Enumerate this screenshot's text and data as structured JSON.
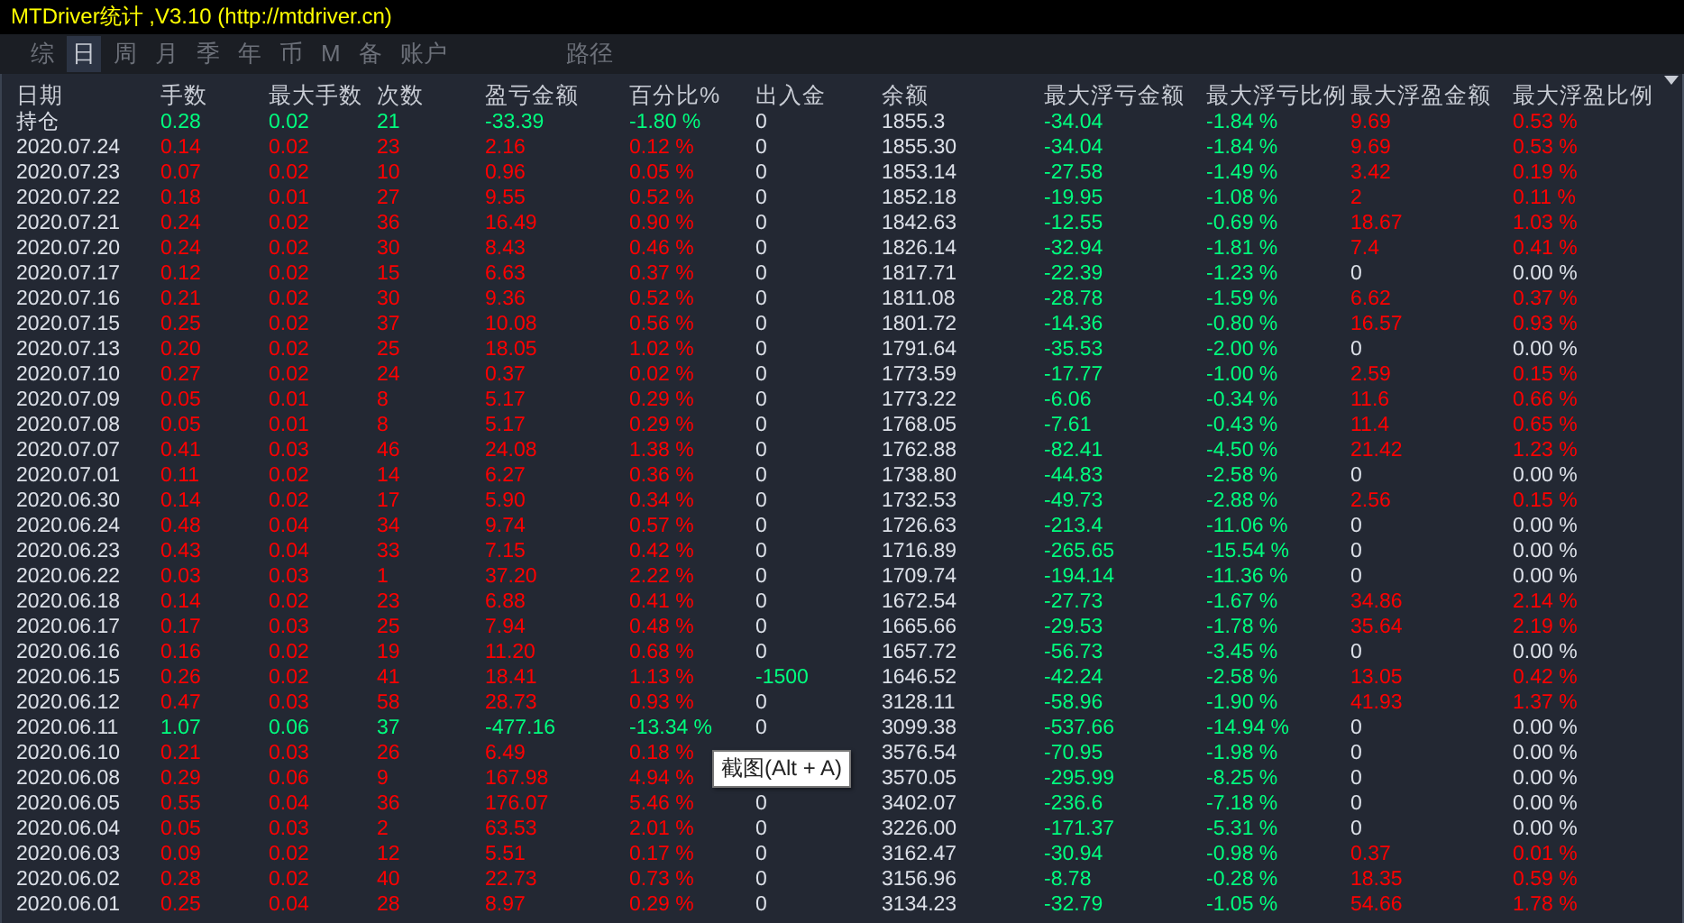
{
  "window": {
    "title": "MTDriver统计 ,V3.10 (http://mtdriver.cn)"
  },
  "tabs": [
    {
      "label": "综",
      "selected": false
    },
    {
      "label": "日",
      "selected": true
    },
    {
      "label": "周",
      "selected": false
    },
    {
      "label": "月",
      "selected": false
    },
    {
      "label": "季",
      "selected": false
    },
    {
      "label": "年",
      "selected": false
    },
    {
      "label": "币",
      "selected": false
    },
    {
      "label": "M",
      "selected": false
    },
    {
      "label": "备",
      "selected": false
    },
    {
      "label": "账户",
      "selected": false
    }
  ],
  "path_button": "路径",
  "table": {
    "columns": [
      "日期",
      "手数",
      "最大手数",
      "次数",
      "盈亏金额",
      "百分比%",
      "出入金",
      "余额",
      "最大浮亏金额",
      "最大浮亏比例",
      "最大浮盈金额",
      "最大浮盈比例"
    ],
    "rows": [
      {
        "cells": [
          "持仓",
          "0.28",
          "0.02",
          "21",
          "-33.39",
          "-1.80 %",
          "0",
          "1855.3",
          "-34.04",
          "-1.84 %",
          "9.69",
          "0.53 %"
        ],
        "loss": true,
        "float_gain": true,
        "cash_out": false
      },
      {
        "cells": [
          "2020.07.24",
          "0.14",
          "0.02",
          "23",
          "2.16",
          "0.12 %",
          "0",
          "1855.30",
          "-34.04",
          "-1.84 %",
          "9.69",
          "0.53 %"
        ],
        "loss": false,
        "float_gain": true,
        "cash_out": false
      },
      {
        "cells": [
          "2020.07.23",
          "0.07",
          "0.02",
          "10",
          "0.96",
          "0.05 %",
          "0",
          "1853.14",
          "-27.58",
          "-1.49 %",
          "3.42",
          "0.19 %"
        ],
        "loss": false,
        "float_gain": true,
        "cash_out": false
      },
      {
        "cells": [
          "2020.07.22",
          "0.18",
          "0.01",
          "27",
          "9.55",
          "0.52 %",
          "0",
          "1852.18",
          "-19.95",
          "-1.08 %",
          "2",
          "0.11 %"
        ],
        "loss": false,
        "float_gain": true,
        "cash_out": false
      },
      {
        "cells": [
          "2020.07.21",
          "0.24",
          "0.02",
          "36",
          "16.49",
          "0.90 %",
          "0",
          "1842.63",
          "-12.55",
          "-0.69 %",
          "18.67",
          "1.03 %"
        ],
        "loss": false,
        "float_gain": true,
        "cash_out": false
      },
      {
        "cells": [
          "2020.07.20",
          "0.24",
          "0.02",
          "30",
          "8.43",
          "0.46 %",
          "0",
          "1826.14",
          "-32.94",
          "-1.81 %",
          "7.4",
          "0.41 %"
        ],
        "loss": false,
        "float_gain": true,
        "cash_out": false
      },
      {
        "cells": [
          "2020.07.17",
          "0.12",
          "0.02",
          "15",
          "6.63",
          "0.37 %",
          "0",
          "1817.71",
          "-22.39",
          "-1.23 %",
          "0",
          "0.00 %"
        ],
        "loss": false,
        "float_gain": false,
        "cash_out": false
      },
      {
        "cells": [
          "2020.07.16",
          "0.21",
          "0.02",
          "30",
          "9.36",
          "0.52 %",
          "0",
          "1811.08",
          "-28.78",
          "-1.59 %",
          "6.62",
          "0.37 %"
        ],
        "loss": false,
        "float_gain": true,
        "cash_out": false
      },
      {
        "cells": [
          "2020.07.15",
          "0.25",
          "0.02",
          "37",
          "10.08",
          "0.56 %",
          "0",
          "1801.72",
          "-14.36",
          "-0.80 %",
          "16.57",
          "0.93 %"
        ],
        "loss": false,
        "float_gain": true,
        "cash_out": false
      },
      {
        "cells": [
          "2020.07.13",
          "0.20",
          "0.02",
          "25",
          "18.05",
          "1.02 %",
          "0",
          "1791.64",
          "-35.53",
          "-2.00 %",
          "0",
          "0.00 %"
        ],
        "loss": false,
        "float_gain": false,
        "cash_out": false
      },
      {
        "cells": [
          "2020.07.10",
          "0.27",
          "0.02",
          "24",
          "0.37",
          "0.02 %",
          "0",
          "1773.59",
          "-17.77",
          "-1.00 %",
          "2.59",
          "0.15 %"
        ],
        "loss": false,
        "float_gain": true,
        "cash_out": false
      },
      {
        "cells": [
          "2020.07.09",
          "0.05",
          "0.01",
          "8",
          "5.17",
          "0.29 %",
          "0",
          "1773.22",
          "-6.06",
          "-0.34 %",
          "11.6",
          "0.66 %"
        ],
        "loss": false,
        "float_gain": true,
        "cash_out": false
      },
      {
        "cells": [
          "2020.07.08",
          "0.05",
          "0.01",
          "8",
          "5.17",
          "0.29 %",
          "0",
          "1768.05",
          "-7.61",
          "-0.43 %",
          "11.4",
          "0.65 %"
        ],
        "loss": false,
        "float_gain": true,
        "cash_out": false
      },
      {
        "cells": [
          "2020.07.07",
          "0.41",
          "0.03",
          "46",
          "24.08",
          "1.38 %",
          "0",
          "1762.88",
          "-82.41",
          "-4.50 %",
          "21.42",
          "1.23 %"
        ],
        "loss": false,
        "float_gain": true,
        "cash_out": false
      },
      {
        "cells": [
          "2020.07.01",
          "0.11",
          "0.02",
          "14",
          "6.27",
          "0.36 %",
          "0",
          "1738.80",
          "-44.83",
          "-2.58 %",
          "0",
          "0.00 %"
        ],
        "loss": false,
        "float_gain": false,
        "cash_out": false
      },
      {
        "cells": [
          "2020.06.30",
          "0.14",
          "0.02",
          "17",
          "5.90",
          "0.34 %",
          "0",
          "1732.53",
          "-49.73",
          "-2.88 %",
          "2.56",
          "0.15 %"
        ],
        "loss": false,
        "float_gain": true,
        "cash_out": false
      },
      {
        "cells": [
          "2020.06.24",
          "0.48",
          "0.04",
          "34",
          "9.74",
          "0.57 %",
          "0",
          "1726.63",
          "-213.4",
          "-11.06 %",
          "0",
          "0.00 %"
        ],
        "loss": false,
        "float_gain": false,
        "cash_out": false
      },
      {
        "cells": [
          "2020.06.23",
          "0.43",
          "0.04",
          "33",
          "7.15",
          "0.42 %",
          "0",
          "1716.89",
          "-265.65",
          "-15.54 %",
          "0",
          "0.00 %"
        ],
        "loss": false,
        "float_gain": false,
        "cash_out": false
      },
      {
        "cells": [
          "2020.06.22",
          "0.03",
          "0.03",
          "1",
          "37.20",
          "2.22 %",
          "0",
          "1709.74",
          "-194.14",
          "-11.36 %",
          "0",
          "0.00 %"
        ],
        "loss": false,
        "float_gain": false,
        "cash_out": false
      },
      {
        "cells": [
          "2020.06.18",
          "0.14",
          "0.02",
          "23",
          "6.88",
          "0.41 %",
          "0",
          "1672.54",
          "-27.73",
          "-1.67 %",
          "34.86",
          "2.14 %"
        ],
        "loss": false,
        "float_gain": true,
        "cash_out": false
      },
      {
        "cells": [
          "2020.06.17",
          "0.17",
          "0.03",
          "25",
          "7.94",
          "0.48 %",
          "0",
          "1665.66",
          "-29.53",
          "-1.78 %",
          "35.64",
          "2.19 %"
        ],
        "loss": false,
        "float_gain": true,
        "cash_out": false
      },
      {
        "cells": [
          "2020.06.16",
          "0.16",
          "0.02",
          "19",
          "11.20",
          "0.68 %",
          "0",
          "1657.72",
          "-56.73",
          "-3.45 %",
          "0",
          "0.00 %"
        ],
        "loss": false,
        "float_gain": false,
        "cash_out": false
      },
      {
        "cells": [
          "2020.06.15",
          "0.26",
          "0.02",
          "41",
          "18.41",
          "1.13 %",
          "-1500",
          "1646.52",
          "-42.24",
          "-2.58 %",
          "13.05",
          "0.42 %"
        ],
        "loss": false,
        "float_gain": true,
        "cash_out": true
      },
      {
        "cells": [
          "2020.06.12",
          "0.47",
          "0.03",
          "58",
          "28.73",
          "0.93 %",
          "0",
          "3128.11",
          "-58.96",
          "-1.90 %",
          "41.93",
          "1.37 %"
        ],
        "loss": false,
        "float_gain": true,
        "cash_out": false
      },
      {
        "cells": [
          "2020.06.11",
          "1.07",
          "0.06",
          "37",
          "-477.16",
          "-13.34 %",
          "0",
          "3099.38",
          "-537.66",
          "-14.94 %",
          "0",
          "0.00 %"
        ],
        "loss": true,
        "float_gain": false,
        "cash_out": false
      },
      {
        "cells": [
          "2020.06.10",
          "0.21",
          "0.03",
          "26",
          "6.49",
          "0.18 %",
          null,
          "3576.54",
          "-70.95",
          "-1.98 %",
          "0",
          "0.00 %"
        ],
        "loss": false,
        "float_gain": false
      },
      {
        "cells": [
          "2020.06.08",
          "0.29",
          "0.06",
          "9",
          "167.98",
          "4.94 %",
          null,
          "3570.05",
          "-295.99",
          "-8.25 %",
          "0",
          "0.00 %"
        ],
        "loss": false,
        "float_gain": false
      },
      {
        "cells": [
          "2020.06.05",
          "0.55",
          "0.04",
          "36",
          "176.07",
          "5.46 %",
          "0",
          "3402.07",
          "-236.6",
          "-7.18 %",
          "0",
          "0.00 %"
        ],
        "loss": false,
        "float_gain": false,
        "cash_out": false
      },
      {
        "cells": [
          "2020.06.04",
          "0.05",
          "0.03",
          "2",
          "63.53",
          "2.01 %",
          "0",
          "3226.00",
          "-171.37",
          "-5.31 %",
          "0",
          "0.00 %"
        ],
        "loss": false,
        "float_gain": false,
        "cash_out": false
      },
      {
        "cells": [
          "2020.06.03",
          "0.09",
          "0.02",
          "12",
          "5.51",
          "0.17 %",
          "0",
          "3162.47",
          "-30.94",
          "-0.98 %",
          "0.37",
          "0.01 %"
        ],
        "loss": false,
        "float_gain": true,
        "cash_out": false
      },
      {
        "cells": [
          "2020.06.02",
          "0.28",
          "0.02",
          "40",
          "22.73",
          "0.73 %",
          "0",
          "3156.96",
          "-8.78",
          "-0.28 %",
          "18.35",
          "0.59 %"
        ],
        "loss": false,
        "float_gain": true,
        "cash_out": false
      },
      {
        "cells": [
          "2020.06.01",
          "0.25",
          "0.04",
          "28",
          "8.97",
          "0.29 %",
          "0",
          "3134.23",
          "-32.79",
          "-1.05 %",
          "54.66",
          "1.78 %"
        ],
        "loss": false,
        "float_gain": true,
        "cash_out": false
      }
    ]
  },
  "tooltip": "截图(Alt + A)"
}
